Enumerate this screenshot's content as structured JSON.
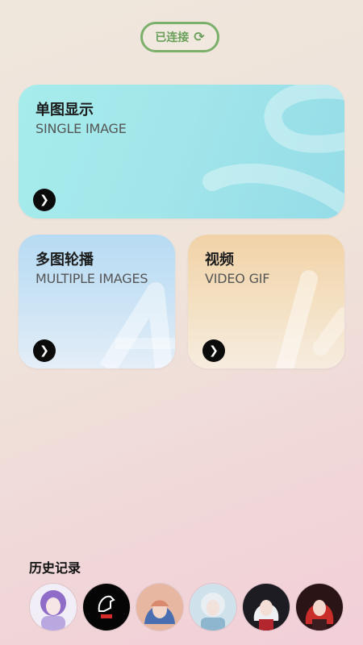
{
  "status": {
    "label": "已连接",
    "icon": "refresh-icon"
  },
  "cards": {
    "single": {
      "title": "单图显示",
      "subtitle": "SINGLE IMAGE",
      "icon": "chevron-right-icon"
    },
    "multi": {
      "title": "多图轮播",
      "subtitle": "MULTIPLE IMAGES",
      "icon": "chevron-right-icon"
    },
    "video": {
      "title": "视频",
      "subtitle": "VIDEO GIF",
      "icon": "chevron-right-icon"
    }
  },
  "history": {
    "title": "历史记录",
    "items": [
      "purple-hair-anime-girl",
      "horse-logo-black",
      "hooded-anime-girl",
      "blue-white-anime-girl",
      "white-hair-anime-girl",
      "red-hair-anime-girl"
    ]
  },
  "colors": {
    "accent_green": "#7bb06b",
    "single_card": "#a3e6ea",
    "multi_card": "#c4e0f5",
    "video_card": "#f3d9b5"
  }
}
